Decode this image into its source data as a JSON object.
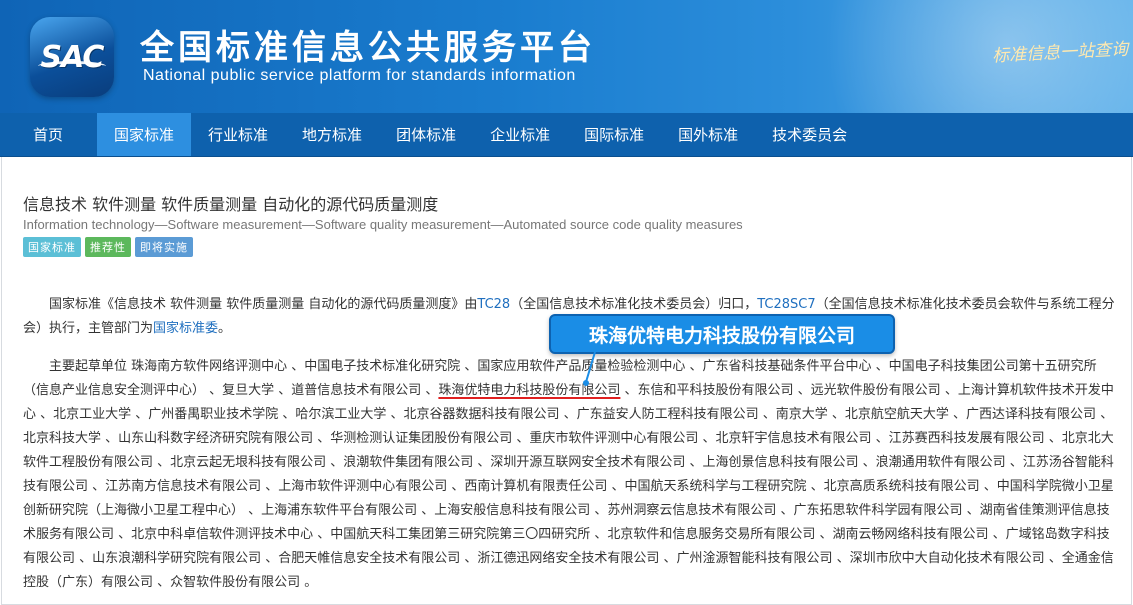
{
  "header": {
    "logo_text": "SAC",
    "title_cn": "全国标准信息公共服务平台",
    "title_en": "National public service platform  for standards information",
    "slogan": "标准信息一站查询"
  },
  "nav": {
    "items": [
      {
        "label": "首页"
      },
      {
        "label": "国家标准"
      },
      {
        "label": "行业标准"
      },
      {
        "label": "地方标准"
      },
      {
        "label": "团体标准"
      },
      {
        "label": "企业标准"
      },
      {
        "label": "国际标准"
      },
      {
        "label": "国外标准"
      },
      {
        "label": "技术委员会"
      }
    ],
    "active": "国家标准"
  },
  "standard": {
    "title_cn": "信息技术 软件测量 软件质量测量 自动化的源代码质量测度",
    "title_en": "Information technology—Software measurement—Software quality measurement—Automated source code quality measures",
    "badges": [
      {
        "label": "国家标准",
        "color": "#5bbfd6"
      },
      {
        "label": "推荐性",
        "color": "#5cb85c"
      },
      {
        "label": "即将实施",
        "color": "#5b9bd5"
      }
    ]
  },
  "intro": {
    "prefix": "国家标准《信息技术 软件测量 软件质量测量 自动化的源代码质量测度》由",
    "tc_link": "TC28",
    "tc_text": "（全国信息技术标准化技术委员会）归口，",
    "sc_link": "TC28SC7",
    "sc_text": "（全国信息技术标准化技术委员会软件与系统工程分会）执行，主管部门为",
    "dept_link": "国家标准委",
    "suffix": "。"
  },
  "drafters": {
    "before": "主要起草单位 珠海南方软件网络评测中心 、中国电子技术标准化研究院 、国家应用软件产品质量检验检测中心 、广东省科技基础条件平台中心 、中国电子科技集团公司第十五研究所（信息产业信息安全测评中心） 、复旦大学 、道普信息技术有限公司 、",
    "highlight": "珠海优特电力科技股份有限公司",
    "after": " 、东信和平科技股份有限公司 、远光软件股份有限公司 、上海计算机软件技术开发中心 、北京工业大学 、广州番禺职业技术学院 、哈尔滨工业大学 、北京谷器数据科技有限公司 、广东益安人防工程科技有限公司 、南京大学 、北京航空航天大学 、广西达译科技有限公司 、北京科技大学 、山东山科数字经济研究院有限公司 、华测检测认证集团股份有限公司 、重庆市软件评测中心有限公司 、北京轩宇信息技术有限公司 、江苏赛西科技发展有限公司 、北京北大软件工程股份有限公司 、北京云起无垠科技有限公司 、浪潮软件集团有限公司 、深圳开源互联网安全技术有限公司 、上海创景信息科技有限公司 、浪潮通用软件有限公司 、江苏汤谷智能科技有限公司 、江苏南方信息技术有限公司 、上海市软件评测中心有限公司 、西南计算机有限责任公司 、中国航天系统科学与工程研究院 、北京高质系统科技有限公司 、中国科学院微小卫星创新研究院（上海微小卫星工程中心） 、上海浦东软件平台有限公司 、上海安般信息科技有限公司 、苏州洞察云信息技术有限公司 、广东拓思软件科学园有限公司 、湖南省佳策测评信息技术服务有限公司 、北京中科卓信软件测评技术中心 、中国航天科工集团第三研究院第三〇四研究所 、北京软件和信息服务交易所有限公司 、湖南云畅网络科技有限公司 、广域铭岛数字科技有限公司 、山东浪潮科学研究院有限公司 、合肥天帷信息安全技术有限公司 、浙江德迅网络安全技术有限公司 、广州淦源智能科技有限公司 、深圳市欣中大自动化技术有限公司 、全通金信控股（广东）有限公司 、众智软件股份有限公司 。"
  },
  "callout": {
    "text": "珠海优特电力科技股份有限公司",
    "color": "#1a8de6"
  }
}
